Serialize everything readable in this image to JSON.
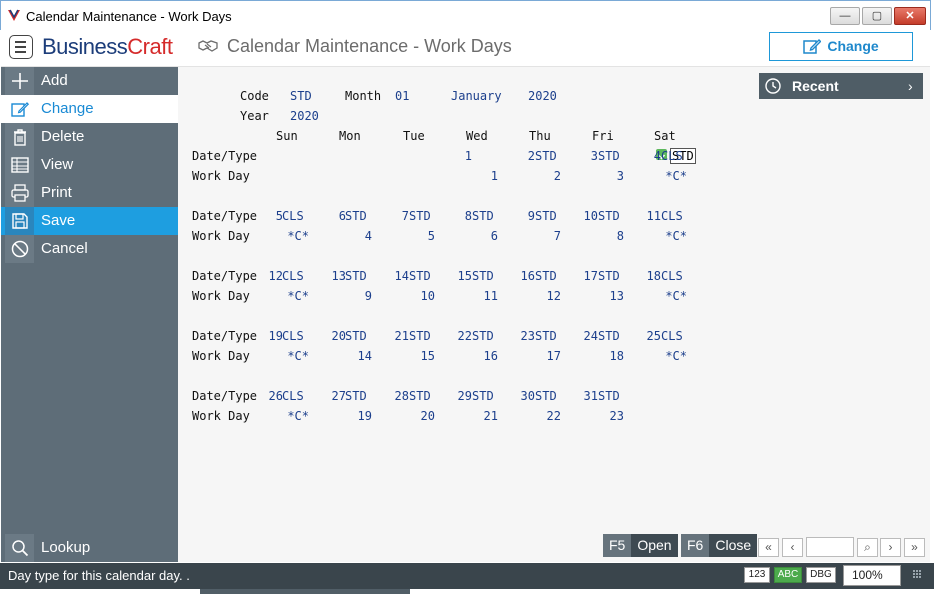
{
  "window": {
    "title": "Calendar Maintenance - Work Days",
    "min_label": "—",
    "max_label": "▢",
    "close_label": "✕"
  },
  "header": {
    "logo_part1": "Business",
    "logo_part2": "Craft",
    "page_title": "Calendar Maintenance - Work Days",
    "mode_button": "Change"
  },
  "sidebar": {
    "items": [
      {
        "label": "Add",
        "icon": "plus-icon"
      },
      {
        "label": "Change",
        "icon": "edit-icon"
      },
      {
        "label": "Delete",
        "icon": "trash-icon"
      },
      {
        "label": "View",
        "icon": "table-icon"
      },
      {
        "label": "Print",
        "icon": "printer-icon"
      },
      {
        "label": "Save",
        "icon": "save-icon"
      },
      {
        "label": "Cancel",
        "icon": "cancel-icon"
      }
    ],
    "lookup_label": "Lookup"
  },
  "form": {
    "code_label": "Code",
    "code_value": "STD",
    "month_label": "Month",
    "month_number": "01",
    "month_name": "January",
    "month_year": "2020",
    "year_label": "Year",
    "year_value": "2020",
    "days_of_week": [
      "Sun",
      "Mon",
      "Tue",
      "Wed",
      "Thu",
      "Fri",
      "Sat"
    ],
    "row_label_type": "Date/Type",
    "row_label_work": "Work Day",
    "weeks": [
      [
        null,
        null,
        null,
        {
          "date": "1",
          "type": "STD",
          "work": "1",
          "editing": true
        },
        {
          "date": "2",
          "type": "STD",
          "work": "2"
        },
        {
          "date": "3",
          "type": "STD",
          "work": "3"
        },
        {
          "date": "4",
          "type": "CLS",
          "work": "*C*"
        }
      ],
      [
        {
          "date": "5",
          "type": "CLS",
          "work": "*C*"
        },
        {
          "date": "6",
          "type": "STD",
          "work": "4"
        },
        {
          "date": "7",
          "type": "STD",
          "work": "5"
        },
        {
          "date": "8",
          "type": "STD",
          "work": "6"
        },
        {
          "date": "9",
          "type": "STD",
          "work": "7"
        },
        {
          "date": "10",
          "type": "STD",
          "work": "8"
        },
        {
          "date": "11",
          "type": "CLS",
          "work": "*C*"
        }
      ],
      [
        {
          "date": "12",
          "type": "CLS",
          "work": "*C*"
        },
        {
          "date": "13",
          "type": "STD",
          "work": "9"
        },
        {
          "date": "14",
          "type": "STD",
          "work": "10"
        },
        {
          "date": "15",
          "type": "STD",
          "work": "11"
        },
        {
          "date": "16",
          "type": "STD",
          "work": "12"
        },
        {
          "date": "17",
          "type": "STD",
          "work": "13"
        },
        {
          "date": "18",
          "type": "CLS",
          "work": "*C*"
        }
      ],
      [
        {
          "date": "19",
          "type": "CLS",
          "work": "*C*"
        },
        {
          "date": "20",
          "type": "STD",
          "work": "14"
        },
        {
          "date": "21",
          "type": "STD",
          "work": "15"
        },
        {
          "date": "22",
          "type": "STD",
          "work": "16"
        },
        {
          "date": "23",
          "type": "STD",
          "work": "17"
        },
        {
          "date": "24",
          "type": "STD",
          "work": "18"
        },
        {
          "date": "25",
          "type": "CLS",
          "work": "*C*"
        }
      ],
      [
        {
          "date": "26",
          "type": "CLS",
          "work": "*C*"
        },
        {
          "date": "27",
          "type": "STD",
          "work": "19"
        },
        {
          "date": "28",
          "type": "STD",
          "work": "20"
        },
        {
          "date": "29",
          "type": "STD",
          "work": "21"
        },
        {
          "date": "30",
          "type": "STD",
          "work": "22"
        },
        {
          "date": "31",
          "type": "STD",
          "work": "23"
        },
        null
      ]
    ]
  },
  "recent": {
    "label": "Recent",
    "chevron": "›"
  },
  "function_keys": [
    {
      "key": "F5",
      "label": "Open"
    },
    {
      "key": "F6",
      "label": "Close"
    }
  ],
  "pager": {
    "first": "«",
    "prev": "‹",
    "search": "⌕",
    "next": "›",
    "last": "»"
  },
  "status": {
    "message": "Day type for this calendar day. .",
    "badge_num": "123",
    "badge_abc": "ABC",
    "badge_dbg": "DBG",
    "zoom": "100%",
    "zoom_chevron": "⌄"
  },
  "colors": {
    "sidebar_bg": "#5e6d78",
    "sidebar_active_text": "#1a8ad4",
    "sidebar_highlight": "#1e9ee0",
    "field_value": "#1c3f8c",
    "logo_blue": "#1c3d7a",
    "logo_red": "#d52b2b",
    "status_bar": "#3a454c"
  }
}
